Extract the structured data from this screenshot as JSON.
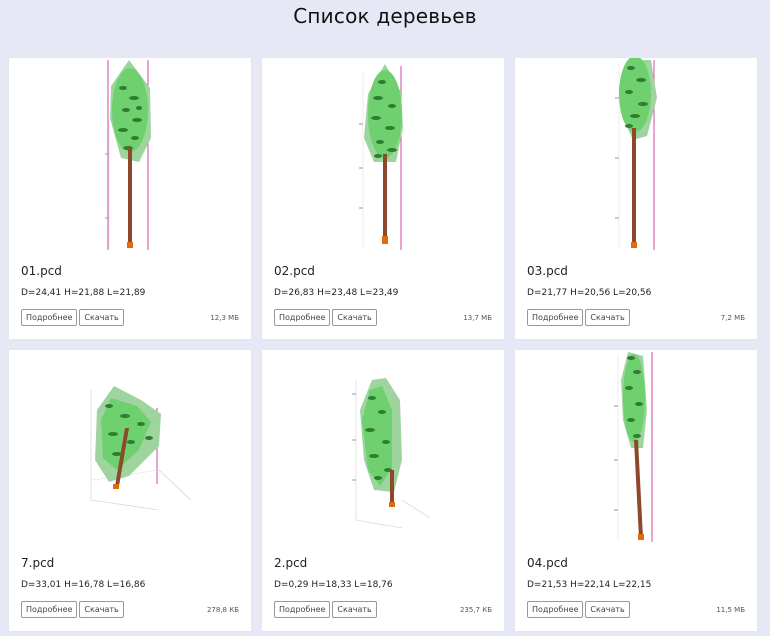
{
  "page": {
    "title": "Список деревьев"
  },
  "cards": [
    {
      "name": "01.pcd",
      "metrics": "D=24,41 H=21,88 L=21,89",
      "size": "12,3 МБ",
      "details_label": "Подробнее",
      "download_label": "Скачать"
    },
    {
      "name": "02.pcd",
      "metrics": "D=26,83 H=23,48 L=23,49",
      "size": "13,7 МБ",
      "details_label": "Подробнее",
      "download_label": "Скачать"
    },
    {
      "name": "03.pcd",
      "metrics": "D=21,77 H=20,56 L=20,56",
      "size": "7,2 МБ",
      "details_label": "Подробнее",
      "download_label": "Скачать"
    },
    {
      "name": "7.pcd",
      "metrics": "D=33,01 H=16,78 L=16,86",
      "size": "278,8 КБ",
      "details_label": "Подробнее",
      "download_label": "Скачать"
    },
    {
      "name": "2.pcd",
      "metrics": "D=0,29 H=18,33 L=18,76",
      "size": "235,7 КБ",
      "details_label": "Подробнее",
      "download_label": "Скачать"
    },
    {
      "name": "04.pcd",
      "metrics": "D=21,53 H=22,14 L=22,15",
      "size": "11,5 МБ",
      "details_label": "Подробнее",
      "download_label": "Скачать"
    }
  ]
}
